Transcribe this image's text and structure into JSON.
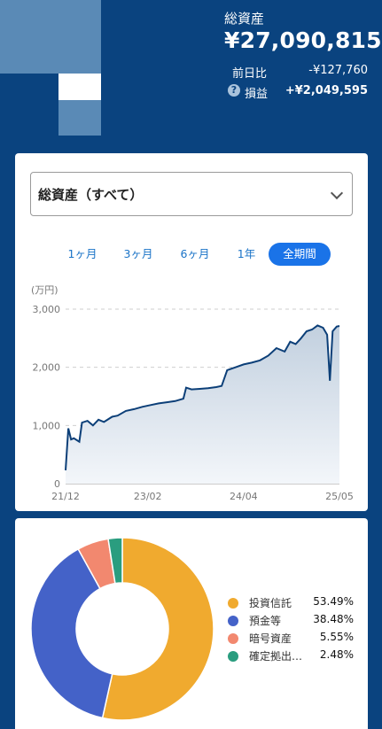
{
  "header": {
    "total_label": "総資産",
    "total_value": "¥27,090,815",
    "day_change_label": "前日比",
    "day_change_value": "-¥127,760",
    "profit_label": "損益",
    "profit_value": "+¥2,049,595",
    "help_glyph": "?"
  },
  "chart_card": {
    "select_label": "総資産（すべて）",
    "tabs": [
      {
        "label": "1ヶ月",
        "active": false
      },
      {
        "label": "3ヶ月",
        "active": false
      },
      {
        "label": "6ヶ月",
        "active": false
      },
      {
        "label": "1年",
        "active": false
      },
      {
        "label": "全期間",
        "active": true
      }
    ],
    "unit_label": "(万円)"
  },
  "chart_data": {
    "type": "area",
    "ylabel": "(万円)",
    "ylim": [
      0,
      3000
    ],
    "y_ticks": [
      "0",
      "1,000",
      "2,000",
      "3,000"
    ],
    "x_ticks": [
      "21/12",
      "23/02",
      "24/04",
      "25/05"
    ],
    "grid": true,
    "series": [
      {
        "values": [
          [
            0.0,
            230
          ],
          [
            0.01,
            950
          ],
          [
            0.02,
            760
          ],
          [
            0.03,
            780
          ],
          [
            0.05,
            720
          ],
          [
            0.06,
            1050
          ],
          [
            0.08,
            1080
          ],
          [
            0.1,
            1000
          ],
          [
            0.12,
            1100
          ],
          [
            0.14,
            1060
          ],
          [
            0.17,
            1150
          ],
          [
            0.19,
            1170
          ],
          [
            0.22,
            1250
          ],
          [
            0.25,
            1280
          ],
          [
            0.28,
            1320
          ],
          [
            0.31,
            1350
          ],
          [
            0.34,
            1380
          ],
          [
            0.37,
            1400
          ],
          [
            0.4,
            1420
          ],
          [
            0.43,
            1460
          ],
          [
            0.44,
            1650
          ],
          [
            0.46,
            1620
          ],
          [
            0.49,
            1630
          ],
          [
            0.52,
            1640
          ],
          [
            0.55,
            1660
          ],
          [
            0.57,
            1680
          ],
          [
            0.59,
            1950
          ],
          [
            0.62,
            2000
          ],
          [
            0.65,
            2050
          ],
          [
            0.68,
            2080
          ],
          [
            0.71,
            2120
          ],
          [
            0.74,
            2200
          ],
          [
            0.77,
            2330
          ],
          [
            0.8,
            2270
          ],
          [
            0.82,
            2440
          ],
          [
            0.84,
            2400
          ],
          [
            0.86,
            2500
          ],
          [
            0.88,
            2620
          ],
          [
            0.9,
            2650
          ],
          [
            0.92,
            2720
          ],
          [
            0.94,
            2680
          ],
          [
            0.955,
            2560
          ],
          [
            0.965,
            1770
          ],
          [
            0.975,
            2620
          ],
          [
            0.99,
            2700
          ],
          [
            1.0,
            2710
          ]
        ]
      }
    ]
  },
  "allocation": {
    "chart_type": "donut",
    "items": [
      {
        "name": "投資信託",
        "value": "53.49%",
        "pct": 53.49,
        "color": "#f0aa2f"
      },
      {
        "name": "預金等",
        "value": "38.48%",
        "pct": 38.48,
        "color": "#4462c8"
      },
      {
        "name": "暗号資産",
        "value": "5.55%",
        "pct": 5.55,
        "color": "#f2886f"
      },
      {
        "name": "確定拠出…",
        "value": "2.48%",
        "pct": 2.48,
        "color": "#2a9d7f"
      }
    ]
  }
}
